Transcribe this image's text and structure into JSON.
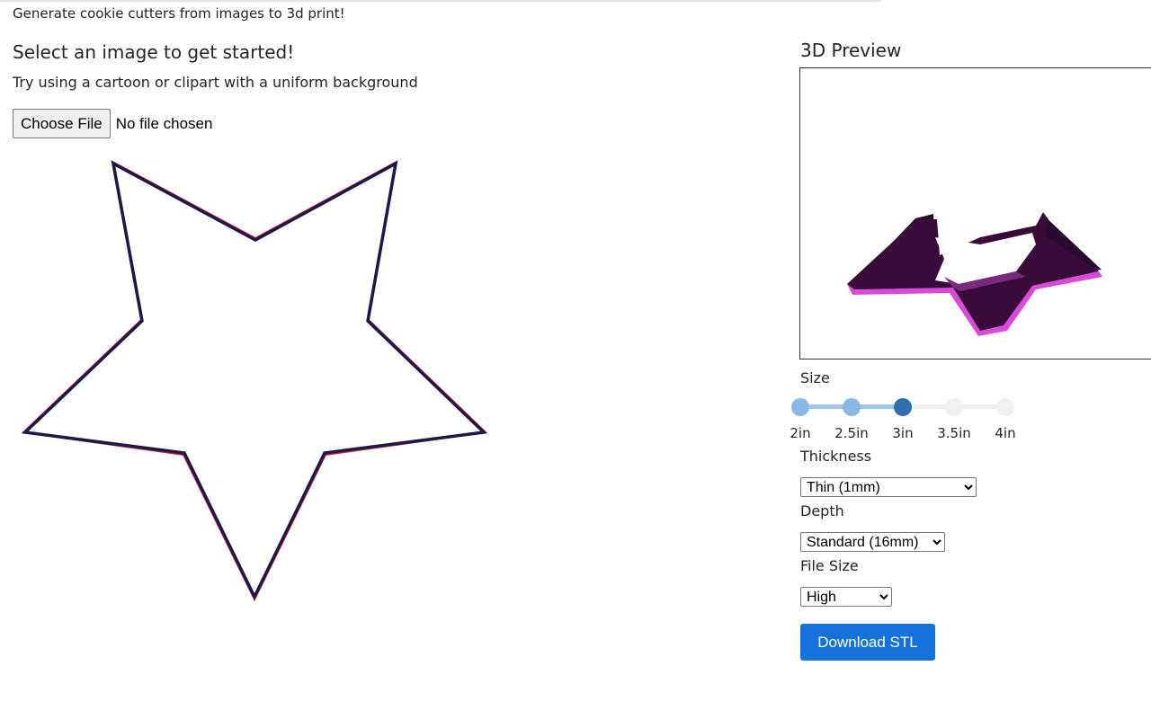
{
  "header": {
    "tagline": "Generate cookie cutters from images to 3d print!"
  },
  "upload": {
    "heading": "Select an image to get started!",
    "hint": "Try using a cartoon or clipart with a uniform background",
    "button_label": "Choose File",
    "status": "No file chosen"
  },
  "preview": {
    "title": "3D Preview"
  },
  "controls": {
    "size": {
      "label": "Size",
      "ticks": [
        "2in",
        "2.5in",
        "3in",
        "3.5in",
        "4in"
      ],
      "selected": "3in",
      "selected_index": 2
    },
    "thickness": {
      "label": "Thickness",
      "selected": "Thin (1mm)"
    },
    "depth": {
      "label": "Depth",
      "selected": "Standard (16mm)"
    },
    "file_size": {
      "label": "File Size",
      "selected": "High"
    },
    "download_label": "Download STL"
  },
  "colors": {
    "accent": "#1572d8",
    "slider_active": "#2f6fad",
    "slider_filled": "#8ab9e6",
    "outline_dark": "#1a1a4a",
    "outline_red": "#e0242a",
    "preview_magenta": "#d84bd8",
    "preview_dark": "#3a0a3a"
  }
}
